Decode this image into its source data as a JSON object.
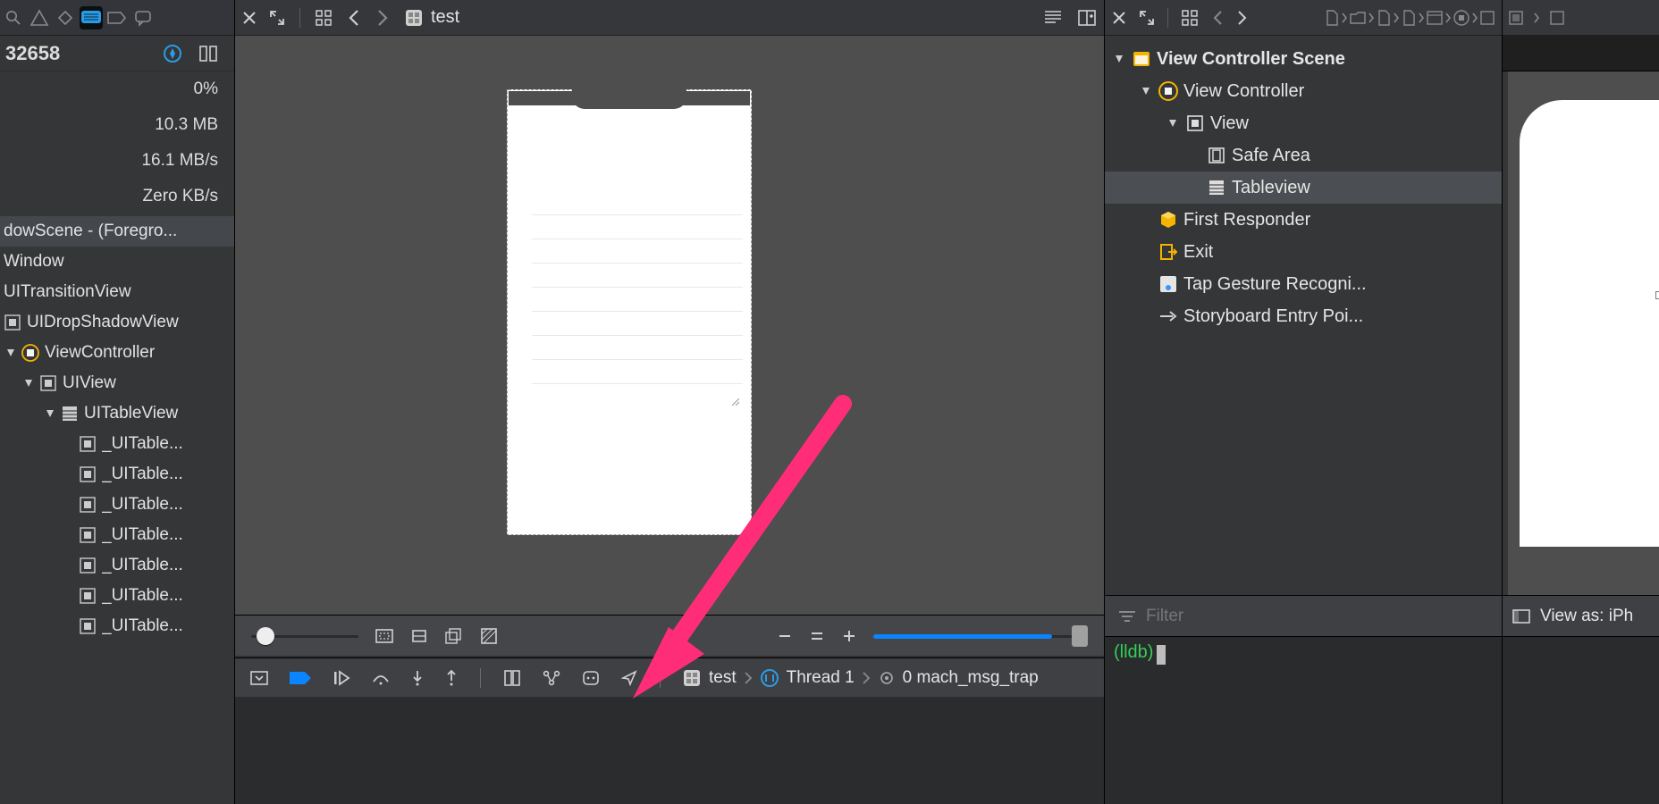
{
  "navigator": {
    "pid": "32658",
    "stats": {
      "cpu": "0%",
      "memory": "10.3 MB",
      "disk": "16.1 MB/s",
      "network": "Zero KB/s"
    },
    "tree": {
      "scene": "dowScene - (Foregro...",
      "window": "Window",
      "transition": "UITransitionView",
      "dropshadow": "UIDropShadowView",
      "viewcontroller": "ViewController",
      "uiview": "UIView",
      "uitableview": "UITableView",
      "cell": "_UITable..."
    }
  },
  "editor": {
    "file": "test",
    "jump_bar": "test"
  },
  "debug": {
    "process": "test",
    "thread": "Thread 1",
    "frame": "0 mach_msg_trap",
    "console_prompt": "(lldb)"
  },
  "outline": {
    "scene": "View Controller Scene",
    "vc": "View Controller",
    "view": "View",
    "safearea": "Safe Area",
    "tableview": "Tableview",
    "firstresponder": "First Responder",
    "exit": "Exit",
    "tap": "Tap Gesture Recogni...",
    "entry": "Storyboard Entry Poi...",
    "filter_placeholder": "Filter"
  },
  "sliver": {
    "view_as": "View as: iPh"
  }
}
